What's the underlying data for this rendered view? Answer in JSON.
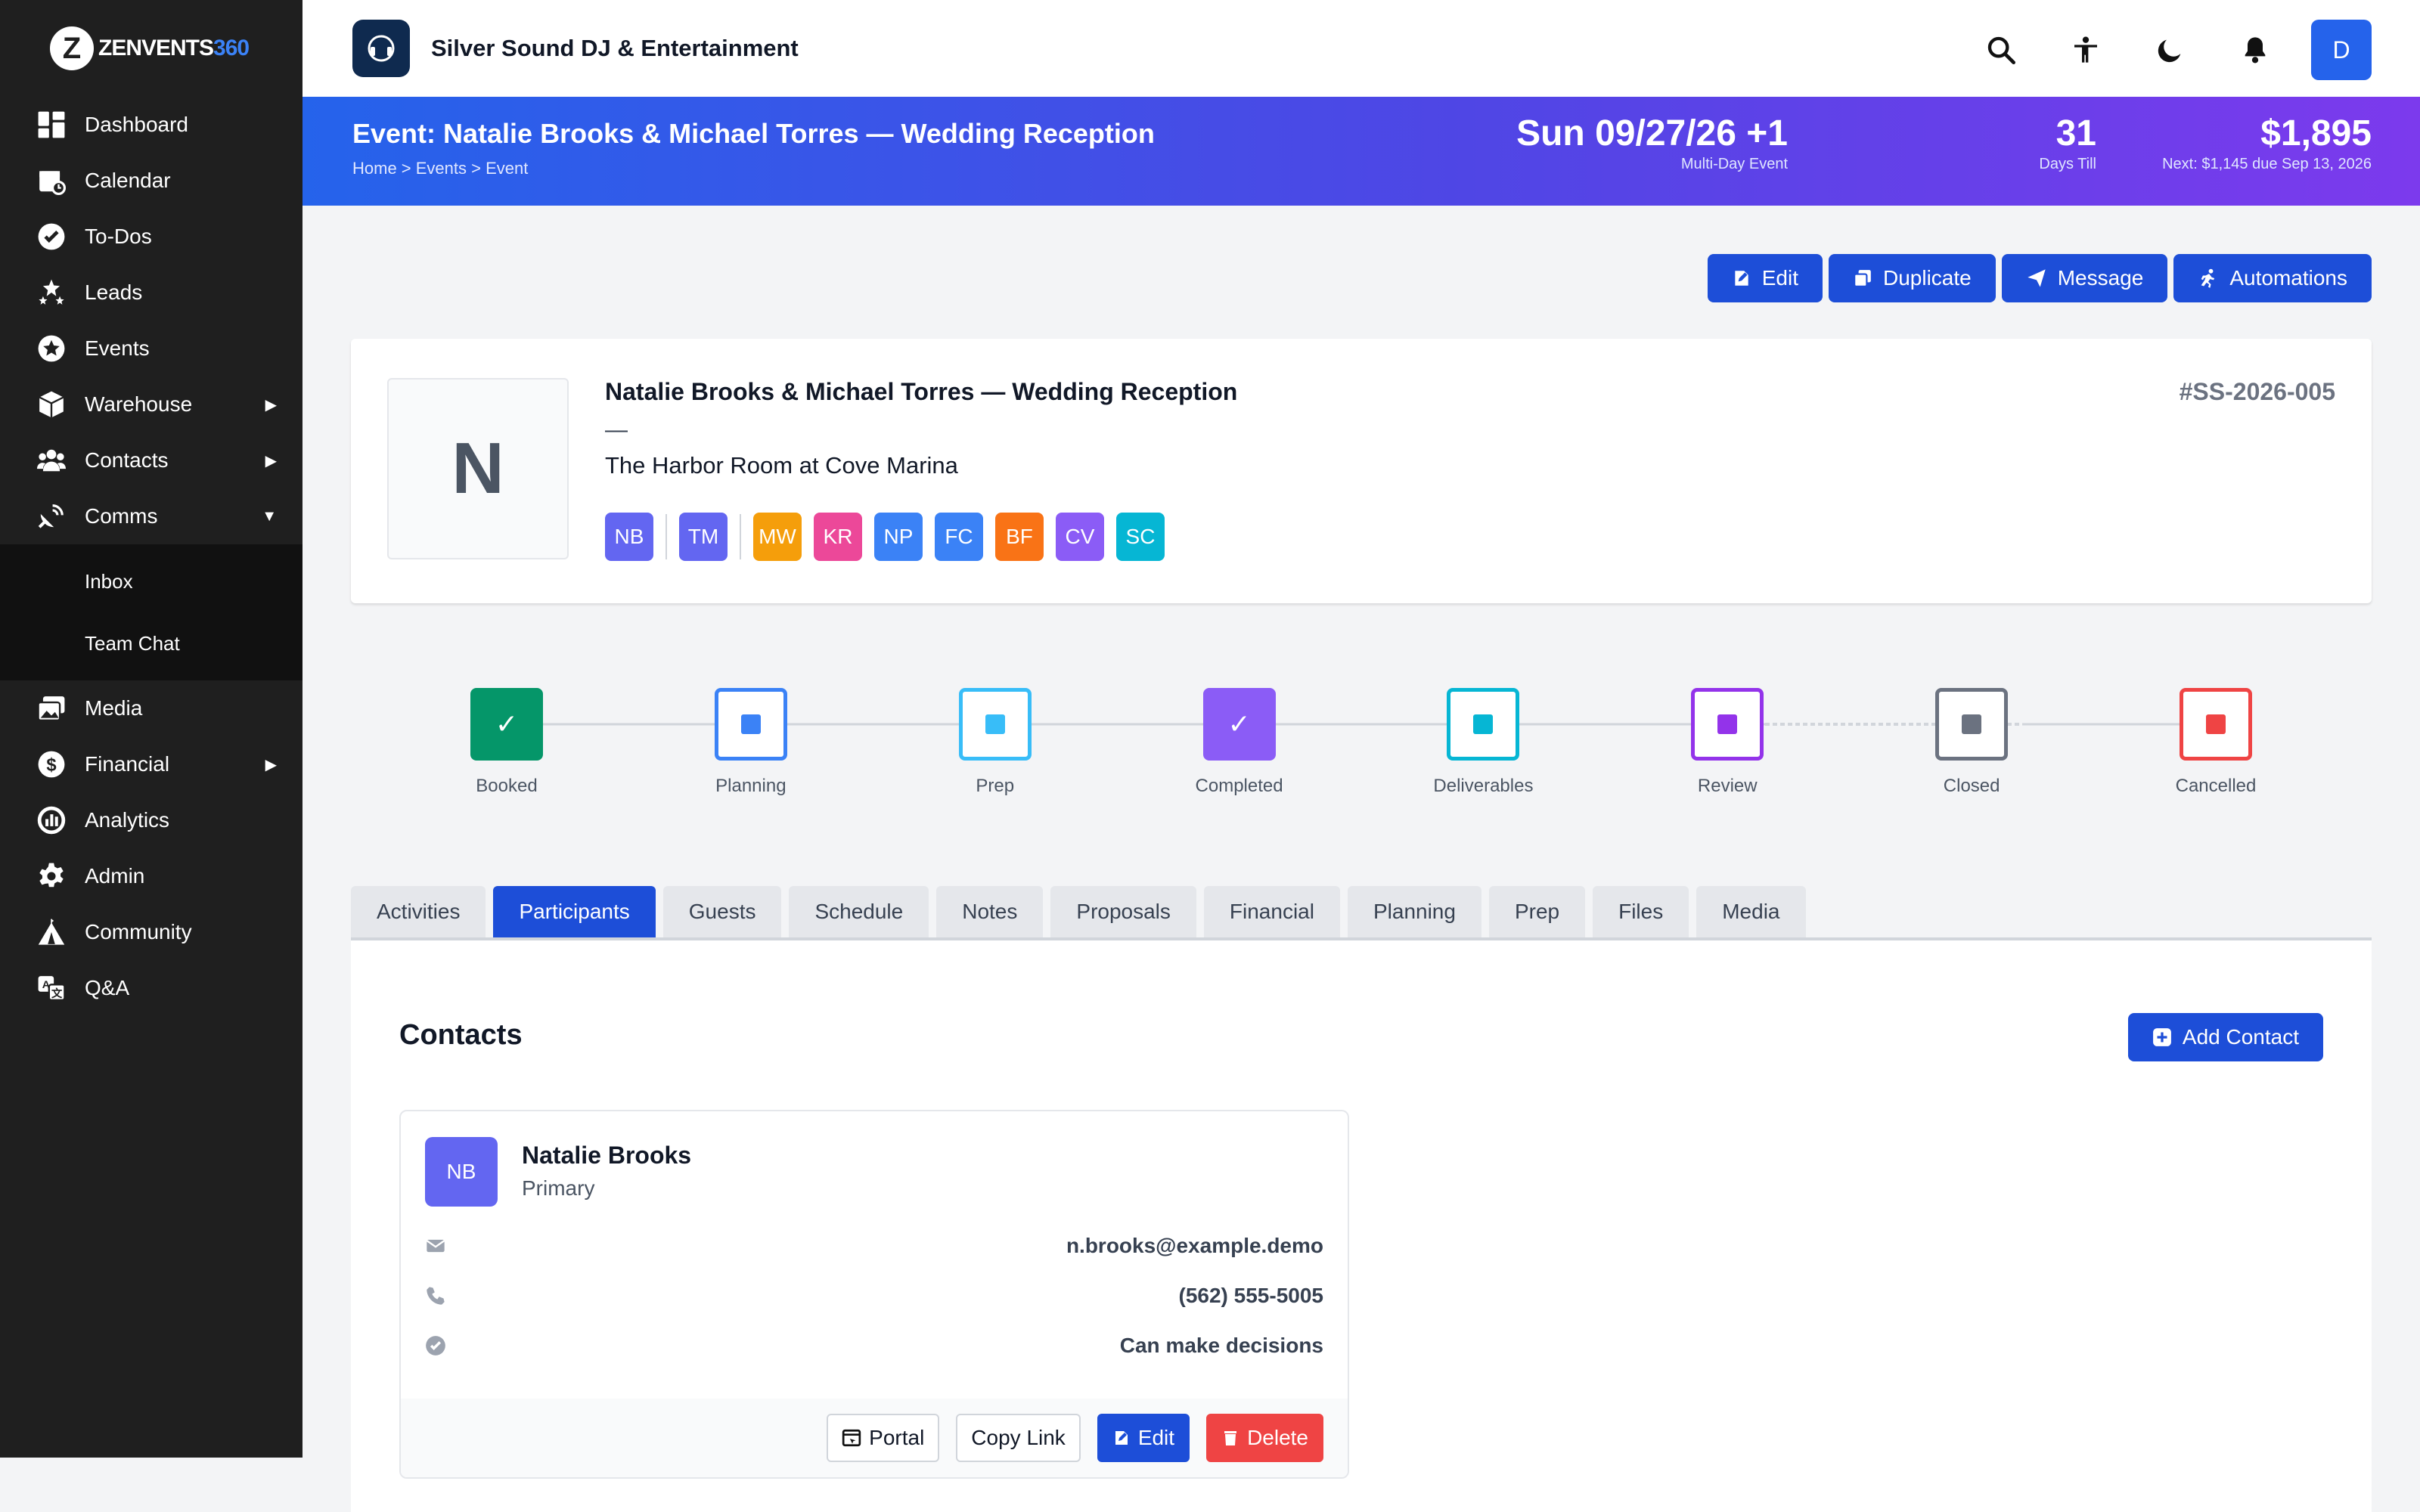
{
  "app": {
    "brand_prefix": "ZENVENTS",
    "brand_suffix": "360"
  },
  "sidebar": {
    "items": [
      {
        "label": "Dashboard",
        "icon": "dashboard-icon"
      },
      {
        "label": "Calendar",
        "icon": "calendar-icon"
      },
      {
        "label": "To-Dos",
        "icon": "check-circle-icon"
      },
      {
        "label": "Leads",
        "icon": "stars-icon"
      },
      {
        "label": "Events",
        "icon": "star-circle-icon"
      },
      {
        "label": "Warehouse",
        "icon": "box-icon",
        "caret": "▶"
      },
      {
        "label": "Contacts",
        "icon": "users-icon",
        "caret": "▶"
      },
      {
        "label": "Comms",
        "icon": "satellite-dish-icon",
        "caret": "▼"
      },
      {
        "label": "Media",
        "icon": "photos-icon"
      },
      {
        "label": "Financial",
        "icon": "dollar-circle-icon",
        "caret": "▶"
      },
      {
        "label": "Analytics",
        "icon": "chart-icon"
      },
      {
        "label": "Admin",
        "icon": "gear-icon"
      },
      {
        "label": "Community",
        "icon": "tent-icon"
      },
      {
        "label": "Q&A",
        "icon": "language-icon"
      }
    ],
    "comms_sub": [
      "Inbox",
      "Team Chat"
    ]
  },
  "topbar": {
    "business_name": "Silver Sound DJ & Entertainment",
    "avatar_initial": "D"
  },
  "hero": {
    "title": "Event: Natalie Brooks & Michael Torres — Wedding Reception",
    "breadcrumb": "Home > Events > Event",
    "date": "Sun 09/27/26 +1",
    "date_sub": "Multi-Day Event",
    "days": "31",
    "days_sub": "Days Till",
    "amount": "$1,895",
    "amount_sub": "Next: $1,145 due Sep 13, 2026"
  },
  "actions": {
    "edit": "Edit",
    "duplicate": "Duplicate",
    "message": "Message",
    "automations": "Automations"
  },
  "event": {
    "initial": "N",
    "name": "Natalie Brooks & Michael Torres — Wedding Reception",
    "dash": "—",
    "venue": "The Harbor Room at Cove Marina",
    "id": "#SS-2026-005",
    "badges": [
      {
        "text": "NB",
        "color": "#6366f1"
      },
      {
        "text": "TM",
        "color": "#6366f1"
      },
      {
        "text": "MW",
        "color": "#f59e0b"
      },
      {
        "text": "KR",
        "color": "#ec4899"
      },
      {
        "text": "NP",
        "color": "#3b82f6"
      },
      {
        "text": "FC",
        "color": "#3b82f6"
      },
      {
        "text": "BF",
        "color": "#f97316"
      },
      {
        "text": "CV",
        "color": "#8b5cf6"
      },
      {
        "text": "SC",
        "color": "#06b6d4"
      }
    ]
  },
  "stages": [
    {
      "label": "Booked",
      "color": "#059669",
      "state": "done"
    },
    {
      "label": "Planning",
      "color": "#3b82f6",
      "state": "pending"
    },
    {
      "label": "Prep",
      "color": "#38bdf8",
      "state": "pending"
    },
    {
      "label": "Completed",
      "color": "#8b5cf6",
      "state": "done"
    },
    {
      "label": "Deliverables",
      "color": "#06b6d4",
      "state": "pending"
    },
    {
      "label": "Review",
      "color": "#9333ea",
      "state": "pending"
    },
    {
      "label": "Closed",
      "color": "#6b7280",
      "state": "pending"
    },
    {
      "label": "Cancelled",
      "color": "#ef4444",
      "state": "pending"
    }
  ],
  "tabs": [
    "Activities",
    "Participants",
    "Guests",
    "Schedule",
    "Notes",
    "Proposals",
    "Financial",
    "Planning",
    "Prep",
    "Files",
    "Media"
  ],
  "active_tab": "Participants",
  "panel": {
    "title": "Contacts",
    "add_label": "Add Contact"
  },
  "contact": {
    "initials": "NB",
    "name": "Natalie Brooks",
    "role": "Primary",
    "email": "n.brooks@example.demo",
    "phone": "(562) 555-5005",
    "permission": "Can make decisions",
    "buttons": {
      "portal": "Portal",
      "copy": "Copy Link",
      "edit": "Edit",
      "delete": "Delete"
    }
  }
}
